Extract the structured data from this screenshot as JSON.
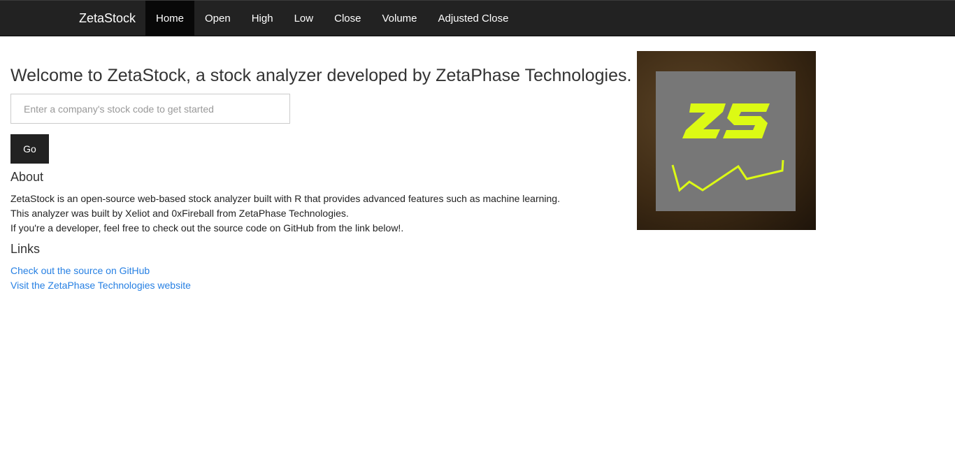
{
  "navbar": {
    "brand": "ZetaStock",
    "items": [
      {
        "label": "Home",
        "active": true
      },
      {
        "label": "Open",
        "active": false
      },
      {
        "label": "High",
        "active": false
      },
      {
        "label": "Low",
        "active": false
      },
      {
        "label": "Close",
        "active": false
      },
      {
        "label": "Volume",
        "active": false
      },
      {
        "label": "Adjusted Close",
        "active": false
      }
    ]
  },
  "main": {
    "welcome": "Welcome to ZetaStock, a stock analyzer developed by ZetaPhase Technologies.",
    "search": {
      "placeholder": "Enter a company's stock code to get started",
      "value": ""
    },
    "go_label": "Go",
    "about": {
      "heading": "About",
      "lines": [
        "ZetaStock is an open-source web-based stock analyzer built with R that provides advanced features such as machine learning.",
        "This analyzer was built by Xeliot and 0xFireball from ZetaPhase Technologies.",
        "If you're a developer, feel free to check out the source code on GitHub from the link below!."
      ]
    },
    "links": {
      "heading": "Links",
      "items": [
        "Check out the source on GitHub",
        "Visit the ZetaPhase Technologies website"
      ]
    }
  },
  "logo": {
    "text": "ZS",
    "accent_color": "#dcfa14",
    "inner_color": "#777777"
  },
  "colors": {
    "navbar_bg": "#222222",
    "nav_active_bg": "#080808",
    "link": "#2780e3"
  }
}
